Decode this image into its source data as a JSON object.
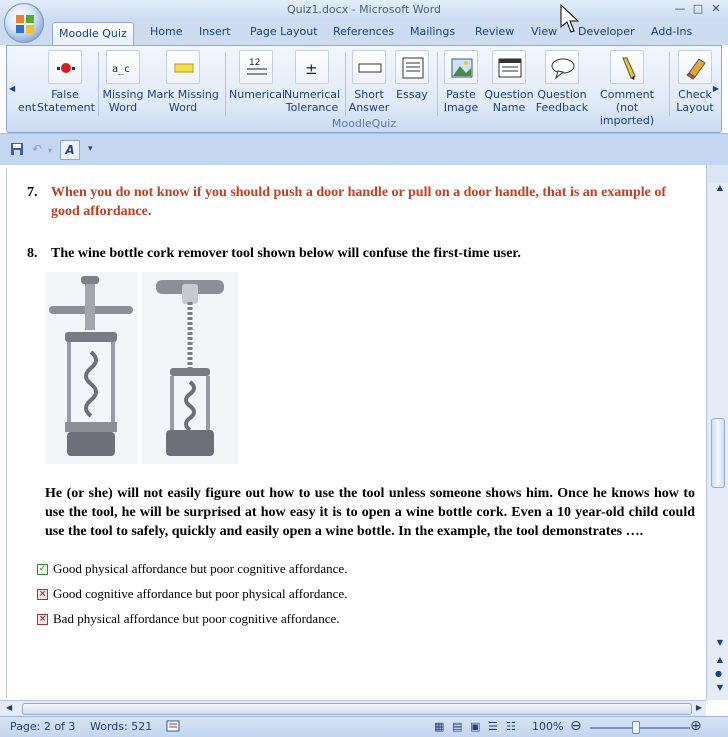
{
  "window": {
    "title": "Quiz1.docx - Microsoft Word"
  },
  "tabs": [
    {
      "label": "Moodle Quiz",
      "active": true
    },
    {
      "label": "Home"
    },
    {
      "label": "Insert"
    },
    {
      "label": "Page Layout"
    },
    {
      "label": "References"
    },
    {
      "label": "Mailings"
    },
    {
      "label": "Review"
    },
    {
      "label": "View"
    },
    {
      "label": "Developer"
    },
    {
      "label": "Add-Ins"
    }
  ],
  "ribbon": {
    "group_label": "MoodleQuiz",
    "items": [
      {
        "label1": "",
        "label2": "ent"
      },
      {
        "label1": "False",
        "label2": "Statement"
      },
      {
        "label1": "Missing",
        "label2": "Word"
      },
      {
        "label1": "Mark Missing",
        "label2": "Word"
      },
      {
        "label1": "Numerical",
        "label2": ""
      },
      {
        "label1": "Numerical",
        "label2": "Tolerance"
      },
      {
        "label1": "Short",
        "label2": "Answer"
      },
      {
        "label1": "Essay",
        "label2": ""
      },
      {
        "label1": "Paste",
        "label2": "Image"
      },
      {
        "label1": "Question",
        "label2": "Name"
      },
      {
        "label1": "Question",
        "label2": "Feedback"
      },
      {
        "label1": "Comment (not",
        "label2": "imported)"
      },
      {
        "label1": "Check",
        "label2": "Layout"
      }
    ]
  },
  "document": {
    "q7": {
      "num": "7.",
      "text": "When you do not know if you should push a door handle or pull on a door handle, that is an example of good affordance."
    },
    "q8": {
      "num": "8.",
      "text": "The wine bottle cork remover tool shown below will confuse the first-time user."
    },
    "q9": {
      "text": "He (or she) will not easily figure out how to use the tool unless someone shows him. Once he knows how to use the tool, he will be surprised at how easy it is to open a wine bottle cork. Even a 10 year-old child could use the tool to safely, quickly and easily open a wine bottle. In the example, the tool demonstrates …."
    },
    "answers": [
      {
        "text": "Good physical affordance but poor cognitive affordance.",
        "correct": true
      },
      {
        "text": "Good cognitive affordance but poor physical affordance.",
        "correct": false
      },
      {
        "text": "Bad physical affordance but poor cognitive affordance.",
        "correct": false
      }
    ]
  },
  "status": {
    "page": "Page: 2 of 3",
    "words": "Words: 521",
    "zoom": "100%"
  },
  "colors": {
    "accent": "#15428b",
    "false_statement": "#c0401f"
  }
}
